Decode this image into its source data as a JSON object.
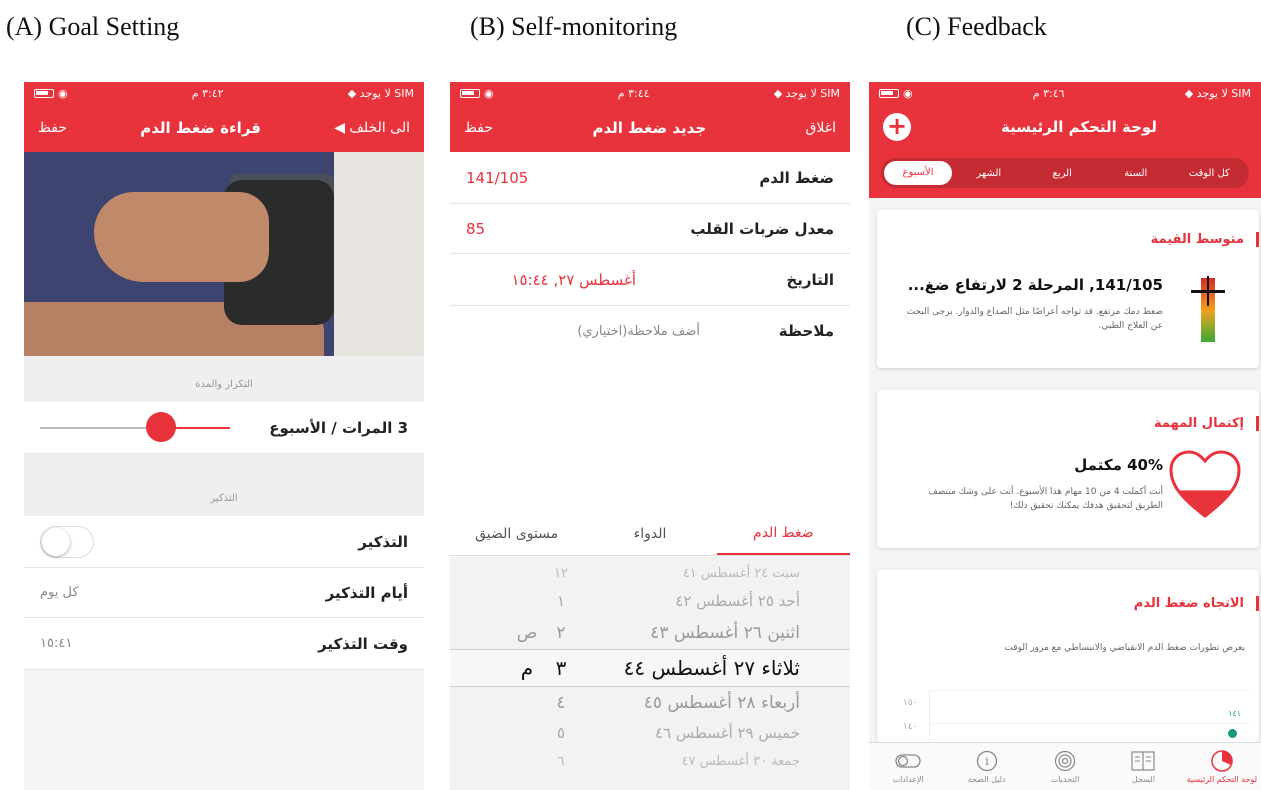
{
  "captions": {
    "a": "(A) Goal Setting",
    "b": "(B) Self-monitoring",
    "c": "(C) Feedback"
  },
  "status": {
    "carrier": "لا يوجد SIM",
    "time_a": "٣:٤٢ م",
    "time_b": "٣:٤٤ م",
    "time_c": "٣:٤٦ م"
  },
  "phone_a": {
    "back": "◀ الى الخلف",
    "title": "قراءة ضغط الدم",
    "save": "حفظ",
    "frequency_header": "التكرار والمدة",
    "frequency_label": "3  المرات / الأسبوع",
    "frequency_value": 3,
    "reminder_header": "التذكير",
    "reminder_label": "التذكير",
    "reminder_days_label": "أيام التذكير",
    "reminder_days_value": "كل يوم",
    "reminder_time_label": "وقت التذكير",
    "reminder_time_value": "١٥:٤١"
  },
  "phone_b": {
    "close": "اغلاق",
    "title": "جديد ضغط الدم",
    "save": "حفظ",
    "fields": [
      {
        "label": "ضغط الدم",
        "value": "141/105"
      },
      {
        "label": "معدل ضربات القلب",
        "value": "85"
      },
      {
        "label": "التاريخ",
        "value": "أغسطس ٢٧, ١٥:٤٤"
      },
      {
        "label": "ملاحظة",
        "value": "أضف ملاحظة(اختياري)"
      }
    ],
    "tabs": {
      "bp": "ضغط الدم",
      "medication": "الدواء",
      "stress": "مستوى الضيق"
    },
    "picker": [
      {
        "day": "سبت ٢٤ أغسطس",
        "minute": "٤١",
        "hour": "١٢",
        "ampm": ""
      },
      {
        "day": "أحد ٢٥ أغسطس",
        "minute": "٤٢",
        "hour": "١",
        "ampm": ""
      },
      {
        "day": "اثنين ٢٦ أغسطس",
        "minute": "٤٣",
        "hour": "٢",
        "ampm": "ص"
      },
      {
        "day": "ثلاثاء ٢٧ أغسطس",
        "minute": "٤٤",
        "hour": "٣",
        "ampm": "م"
      },
      {
        "day": "أربعاء ٢٨ أغسطس",
        "minute": "٤٥",
        "hour": "٤",
        "ampm": ""
      },
      {
        "day": "خميس ٢٩ أغسطس",
        "minute": "٤٦",
        "hour": "٥",
        "ampm": ""
      },
      {
        "day": "جمعة ٣٠ أغسطس",
        "minute": "٤٧",
        "hour": "٦",
        "ampm": ""
      }
    ]
  },
  "phone_c": {
    "title": "لوحة التحكم الرئيسية",
    "segments": {
      "all": "كل الوقت",
      "year": "السنة",
      "quarter": "الربع",
      "month": "الشهر",
      "week": "الأسبوع"
    },
    "avg_card": {
      "title": "متوسط القيمة",
      "main": "141/105, المرحلة 2 لارتفاع ضغ...",
      "desc": "ضغط دمك مرتفع. قد تواجه أعراضًا مثل الصداع والدوار. يرجى البحث عن العلاج الطبي."
    },
    "task_card": {
      "title": "إكتمال المهمة",
      "main": "40% مكتمل",
      "percent": 40,
      "desc": "أنت أكملت 4 من 10 مهام هذا الأسبوع. أنت على وشك منتصف الطريق لتحقيق هدفك يمكنك تحقيق ذلك!"
    },
    "trend_card": {
      "title": "الاتجاه ضغط الدم",
      "desc": "يعرض تطورات ضغط الدم الانقباضي والانبساطي مع مرور الوقت",
      "tick_top": "١٥٠",
      "tick_mid": "١٤٠",
      "point_label": "١٤١"
    },
    "nav": {
      "settings": "الإعدادات",
      "health": "دليل الصحة",
      "challenges": "التحديات",
      "log": "السجل",
      "dashboard": "لوحة التحكم الرئيسية"
    }
  },
  "colors": {
    "accent": "#e8323c",
    "green": "#1a9a7a"
  }
}
